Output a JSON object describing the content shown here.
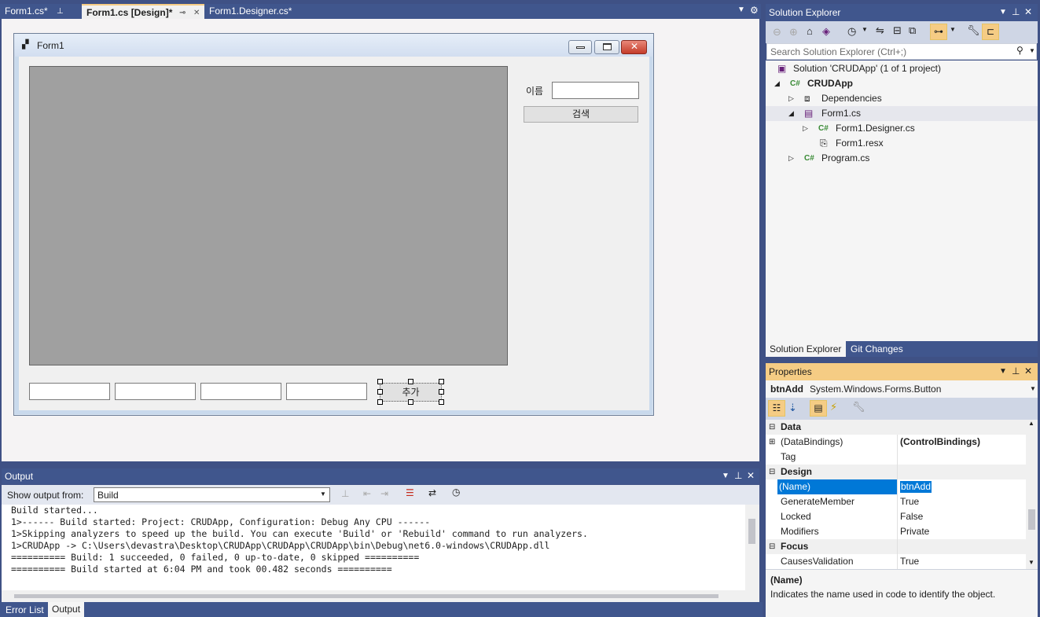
{
  "tabs": [
    {
      "label": "Form1.cs*",
      "active": false
    },
    {
      "label": "Form1.cs [Design]*",
      "active": true
    },
    {
      "label": "Form1.Designer.cs*",
      "active": false
    }
  ],
  "form": {
    "title": "Form1",
    "name_label": "이름",
    "search_button": "검색",
    "add_button": "추가",
    "name_value": "",
    "textboxes": [
      "",
      "",
      "",
      ""
    ]
  },
  "output": {
    "title": "Output",
    "show_from_label": "Show output from:",
    "source": "Build",
    "lines": [
      "Build started...",
      "1>------ Build started: Project: CRUDApp, Configuration: Debug Any CPU ------",
      "1>Skipping analyzers to speed up the build. You can execute 'Build' or 'Rebuild' command to run analyzers.",
      "1>CRUDApp -> C:\\Users\\devastra\\Desktop\\CRUDApp\\CRUDApp\\CRUDApp\\bin\\Debug\\net6.0-windows\\CRUDApp.dll",
      "========== Build: 1 succeeded, 0 failed, 0 up-to-date, 0 skipped ==========",
      "========== Build started at 6:04 PM and took 00.482 seconds =========="
    ]
  },
  "bottom_tabs": [
    "Error List",
    "Output"
  ],
  "solution_explorer": {
    "title": "Solution Explorer",
    "search_placeholder": "Search Solution Explorer (Ctrl+;)",
    "tree": [
      {
        "label": "Solution 'CRUDApp'   (1 of 1 project)",
        "icon": "solution-icon"
      },
      {
        "label": "CRUDApp",
        "icon": "csharp-project-icon",
        "bold": true
      },
      {
        "label": "Dependencies",
        "icon": "dependencies-icon"
      },
      {
        "label": "Form1.cs",
        "icon": "form-icon",
        "selected": true
      },
      {
        "label": "Form1.Designer.cs",
        "icon": "csharp-file-icon"
      },
      {
        "label": "Form1.resx",
        "icon": "resx-file-icon"
      },
      {
        "label": "Program.cs",
        "icon": "csharp-file-icon"
      }
    ],
    "tabs": [
      "Solution Explorer",
      "Git Changes"
    ]
  },
  "properties": {
    "title": "Properties",
    "object_name": "btnAdd",
    "object_type": "System.Windows.Forms.Button",
    "rows": [
      {
        "category": true,
        "name": "Data"
      },
      {
        "name": "(DataBindings)",
        "value": "(ControlBindings)",
        "expandable": true,
        "bold_value": true
      },
      {
        "name": "Tag",
        "value": ""
      },
      {
        "category": true,
        "name": "Design"
      },
      {
        "name": "(Name)",
        "value": "btnAdd",
        "selected": true
      },
      {
        "name": "GenerateMember",
        "value": "True"
      },
      {
        "name": "Locked",
        "value": "False"
      },
      {
        "name": "Modifiers",
        "value": "Private"
      },
      {
        "category": true,
        "name": "Focus"
      },
      {
        "name": "CausesValidation",
        "value": "True"
      }
    ],
    "desc_title": "(Name)",
    "desc_text": "Indicates the name used in code to identify the object."
  },
  "colors": {
    "accent": "#40568d",
    "active_tab": "#f5cc84",
    "selection": "#0078d7"
  }
}
